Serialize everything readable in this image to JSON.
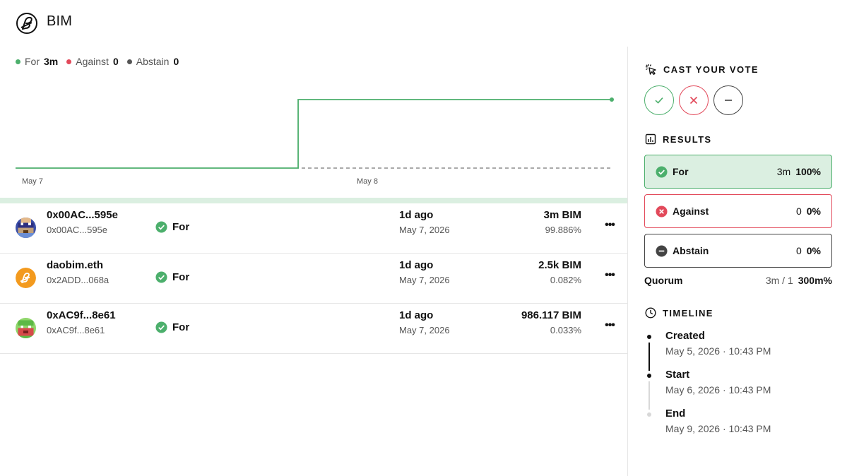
{
  "header": {
    "title": "BIM",
    "logo_icon": "dao-logo-icon"
  },
  "legend": [
    {
      "label": "For",
      "value": "3m",
      "color": "#4caf6c"
    },
    {
      "label": "Against",
      "value": "0",
      "color": "#e2495a"
    },
    {
      "label": "Abstain",
      "value": "0",
      "color": "#555555"
    }
  ],
  "chart_data": {
    "type": "line",
    "x_ticks": [
      "May 7",
      "May 8"
    ],
    "series": [
      {
        "name": "For",
        "color": "#4caf6c",
        "points": [
          {
            "x": "start",
            "y": 0
          },
          {
            "x": "step",
            "y": 0
          },
          {
            "x": "step",
            "y": 3000000
          },
          {
            "x": "end",
            "y": 3000000
          }
        ]
      }
    ],
    "baseline": "dashed",
    "grid": false
  },
  "votes": [
    {
      "name": "0x00AC...595e",
      "address": "0x00AC...595e",
      "choice": "For",
      "time": "1d ago",
      "date": "May 7, 2026",
      "power": "3m BIM",
      "pct": "99.886%",
      "avatar": "pixel-avatar-blue"
    },
    {
      "name": "daobim.eth",
      "address": "0x2ADD...068a",
      "choice": "For",
      "time": "1d ago",
      "date": "May 7, 2026",
      "power": "2.5k BIM",
      "pct": "0.082%",
      "avatar": "bim-logo-avatar"
    },
    {
      "name": "0xAC9f...8e61",
      "address": "0xAC9f...8e61",
      "choice": "For",
      "time": "1d ago",
      "date": "May 7, 2026",
      "power": "986.117 BIM",
      "pct": "0.033%",
      "avatar": "pixel-avatar-green"
    }
  ],
  "cast": {
    "heading": "CAST YOUR VOTE"
  },
  "results": {
    "heading": "RESULTS",
    "items": [
      {
        "label": "For",
        "amount": "3m",
        "pct": "100%"
      },
      {
        "label": "Against",
        "amount": "0",
        "pct": "0%"
      },
      {
        "label": "Abstain",
        "amount": "0",
        "pct": "0%"
      }
    ],
    "quorum": {
      "label": "Quorum",
      "ratio": "3m / 1",
      "pct": "300m%"
    }
  },
  "timeline": {
    "heading": "TIMELINE",
    "items": [
      {
        "title": "Created",
        "date": "May 5, 2026 · 10:43 PM"
      },
      {
        "title": "Start",
        "date": "May 6, 2026 · 10:43 PM"
      },
      {
        "title": "End",
        "date": "May 9, 2026 · 10:43 PM"
      }
    ]
  },
  "colors": {
    "for": "#4caf6c",
    "against": "#e2495a",
    "abstain": "#444444",
    "for_bg": "#dbefe1"
  }
}
